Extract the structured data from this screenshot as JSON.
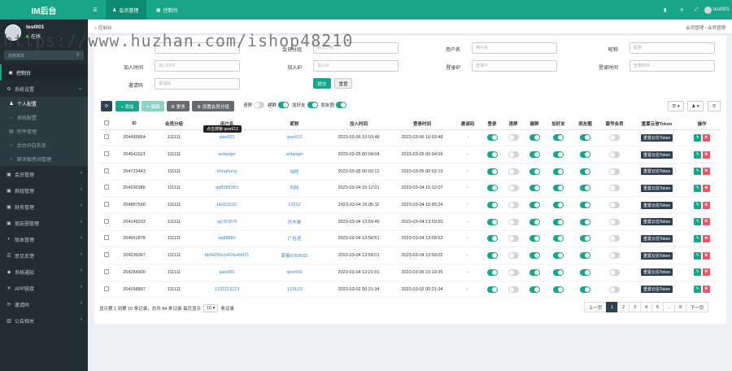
{
  "app": {
    "logo": "IM后台"
  },
  "user": {
    "name": "test001",
    "status": "在线"
  },
  "sidebar": {
    "search_placeholder": "搜索菜单",
    "items": [
      {
        "label": "控制台",
        "icon": "◉"
      },
      {
        "label": "系统设置",
        "icon": "⚙",
        "arrow": "⌄"
      },
      {
        "label": "个人配置",
        "icon": "♟"
      },
      {
        "label": "系统配置",
        "icon": "○"
      },
      {
        "label": "附件管理",
        "icon": "▤"
      },
      {
        "label": "后台IP白名单",
        "icon": "○"
      },
      {
        "label": "聊天敏感词管理",
        "icon": "○"
      },
      {
        "label": "会员管理",
        "icon": "▣",
        "arrow": "‹"
      },
      {
        "label": "群组管理",
        "icon": "▣",
        "arrow": "‹"
      },
      {
        "label": "财务管理",
        "icon": "▣",
        "arrow": "‹"
      },
      {
        "label": "朋友圈管理",
        "icon": "▣",
        "arrow": "‹"
      },
      {
        "label": "版本管理",
        "icon": "◐",
        "arrow": "‹"
      },
      {
        "label": "意见反馈",
        "icon": "☰",
        "arrow": "‹"
      },
      {
        "label": "系统通知",
        "icon": "◆",
        "arrow": "‹"
      },
      {
        "label": "APP链接",
        "icon": "✈",
        "arrow": "‹"
      },
      {
        "label": "邀请码",
        "icon": "⟳",
        "arrow": "‹"
      },
      {
        "label": "公告相关",
        "icon": "▥",
        "arrow": "‹"
      }
    ]
  },
  "topbar": {
    "menu_icon": "☰",
    "tabs": [
      {
        "label": "会员管理",
        "icon": "♟"
      },
      {
        "label": "控制台",
        "icon": "▣"
      }
    ],
    "right_icons": [
      "▮",
      "✕",
      "⤢"
    ],
    "user": "test001"
  },
  "watermark": "https://www.huzhan.com/ishop48210",
  "breadcrumb": {
    "left": "控制台",
    "right": "会员管理 › 会员管理"
  },
  "filters": {
    "row1": [
      {
        "label": "",
        "placeholder": "",
        "x": 0
      },
      {
        "label": "会员分组",
        "placeholder": "会员分组"
      },
      {
        "label": "用户名",
        "placeholder": "用户名"
      },
      {
        "label": "昵称",
        "placeholder": "昵称"
      }
    ],
    "row2": [
      {
        "label": "加入时间",
        "placeholder": "加入时间"
      },
      {
        "label": "加入IP",
        "placeholder": "加入IP"
      },
      {
        "label": "登录IP",
        "placeholder": "登录IP"
      },
      {
        "label": "登录时间",
        "placeholder": "登录时间"
      }
    ],
    "row3": [
      {
        "label": "邀请码",
        "placeholder": "邀请码"
      }
    ],
    "submit": "提交",
    "reset": "重置"
  },
  "toolbar": {
    "refresh": "⟳",
    "add": "+ 添加",
    "edit": "✎ 编辑",
    "more": "⚙ 更多",
    "set_group": "⚙ 设置会员分组",
    "toggles": [
      {
        "label": "语屏",
        "on": false
      },
      {
        "label": "建群",
        "on": true
      },
      {
        "label": "加好友",
        "on": true
      },
      {
        "label": "朋友圈",
        "on": true
      }
    ],
    "right": [
      "☰ ▾",
      "♟ ▾",
      "⚲"
    ]
  },
  "table": {
    "headers": [
      "",
      "ID",
      "会员分组",
      "用户名",
      "昵称",
      "加入时间",
      "登录时间",
      "邀请码",
      "登录",
      "语屏",
      "建群",
      "加好友",
      "朋友圈",
      "靓号会员",
      "重置云信Token",
      "操作"
    ],
    "tooltip": "点击搜索 qwe612",
    "token_label": "重置云信Token",
    "rows": [
      {
        "id": "204495864",
        "group": "111111",
        "username": "qwe612",
        "nickname": "qwe612",
        "join": "2023-03-06 10:03:48",
        "login": "2023-03-06 10:03:48",
        "code": "-",
        "sw": [
          1,
          0,
          1,
          1,
          1,
          0
        ]
      },
      {
        "id": "204541621",
        "group": "111111",
        "username": "anfangel",
        "nickname": "anfangel",
        "join": "2023-03-05 00:04:04",
        "login": "2023-03-05 00:04:06",
        "code": "-",
        "sw": [
          1,
          0,
          1,
          1,
          1,
          0
        ]
      },
      {
        "id": "204723443",
        "group": "111111",
        "username": "donghong",
        "nickname": "咕咚",
        "join": "2023-03-05 00:02:12",
        "login": "2023-03-05 00:02:15",
        "code": "-",
        "sw": [
          1,
          0,
          1,
          1,
          1,
          0
        ]
      },
      {
        "id": "204200386",
        "group": "111111",
        "username": "qq8388383",
        "nickname": "阿阿",
        "join": "2023-03-04 15:12:01",
        "login": "2023-03-04 15:12:07",
        "code": "-",
        "sw": [
          1,
          0,
          1,
          1,
          1,
          0
        ]
      },
      {
        "id": "204887590",
        "group": "111111",
        "username": "bb323232",
        "nickname": "23232",
        "join": "2023-03-04 15:05:11",
        "login": "2023-03-04 15:05:24",
        "code": "-",
        "sw": [
          1,
          0,
          1,
          1,
          1,
          0
        ]
      },
      {
        "id": "204149233",
        "group": "111111",
        "username": "qq787878",
        "nickname": "仿羊羹",
        "join": "2023-03-04 13:59:49",
        "login": "2023-03-04 13:59:50",
        "code": "-",
        "sw": [
          1,
          0,
          1,
          1,
          1,
          0
        ]
      },
      {
        "id": "204661878",
        "group": "111111",
        "username": "qq88880",
        "nickname": "广告语",
        "join": "2023-03-04 13:58:51",
        "login": "2023-03-04 13:58:53",
        "code": "-",
        "sw": [
          1,
          0,
          1,
          1,
          1,
          0
        ]
      },
      {
        "id": "204236067",
        "group": "111111",
        "username": "bb84256cb424a4d421",
        "nickname": "跟着8782682",
        "join": "2023-03-04 13:58:01",
        "login": "2023-03-04 13:58:02",
        "code": "-",
        "sw": [
          1,
          0,
          1,
          1,
          1,
          0
        ]
      },
      {
        "id": "204284900",
        "group": "111111",
        "username": "qwe666",
        "nickname": "qwe666",
        "join": "2023-03-04 13:21:01",
        "login": "2023-03-06 23:19:35",
        "code": "-",
        "sw": [
          1,
          0,
          1,
          1,
          1,
          0
        ]
      },
      {
        "id": "204268807",
        "group": "111111",
        "username": "1231213213",
        "nickname": "123123",
        "join": "2023-03-02 00:21:34",
        "login": "2023-03-02 00:21:34",
        "code": "-",
        "sw": [
          1,
          0,
          1,
          1,
          1,
          0
        ]
      }
    ]
  },
  "footer": {
    "summary": "显示第 1 到第 10 条记录，总共 84 条记录 每页显示",
    "page_size": "10 ▾",
    "suffix": "条记录",
    "pages": [
      "上一页",
      "1",
      "2",
      "3",
      "4",
      "5",
      "...",
      "9",
      "下一页"
    ],
    "current": "1"
  }
}
